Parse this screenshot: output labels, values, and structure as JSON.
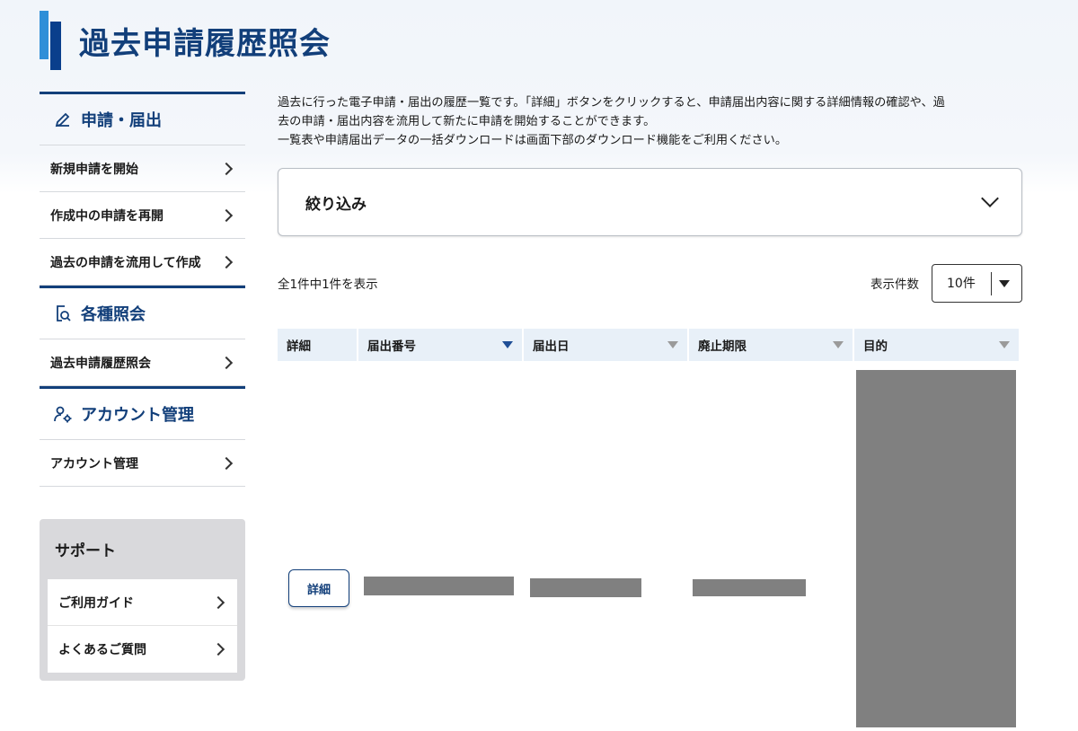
{
  "page": {
    "title": "過去申請履歴照会"
  },
  "sidebar": {
    "sections": [
      {
        "heading": "申請・届出",
        "icon": "pencil-icon",
        "items": [
          "新規申請を開始",
          "作成中の申請を再開",
          "過去の申請を流用して作成"
        ]
      },
      {
        "heading": "各種照会",
        "icon": "document-search-icon",
        "items": [
          "過去申請履歴照会"
        ]
      },
      {
        "heading": "アカウント管理",
        "icon": "user-gear-icon",
        "items": [
          "アカウント管理"
        ]
      }
    ],
    "support": {
      "title": "サポート",
      "items": [
        "ご利用ガイド",
        "よくあるご質問"
      ]
    }
  },
  "main": {
    "description": [
      "過去に行った電子申請・届出の履歴一覧です。「詳細」ボタンをクリックすると、申請届出内容に関する詳細情報の確認や、過",
      "去の申請・届出内容を流用して新たに申請を開始することができます。",
      "一覧表や申請届出データの一括ダウンロードは画面下部のダウンロード機能をご利用ください。"
    ],
    "filter_label": "絞り込み",
    "count_text": "全1件中1件を表示",
    "per_page_label": "表示件数",
    "per_page_value": "10件",
    "table": {
      "columns": [
        "詳細",
        "届出番号",
        "届出日",
        "廃止期限",
        "目的"
      ],
      "row_button": "詳細"
    }
  },
  "colors": {
    "brand_navy": "#123f7a",
    "accent_blue": "#2f8fd8",
    "header_bg": "#e8f0f8",
    "redaction": "#808080"
  }
}
